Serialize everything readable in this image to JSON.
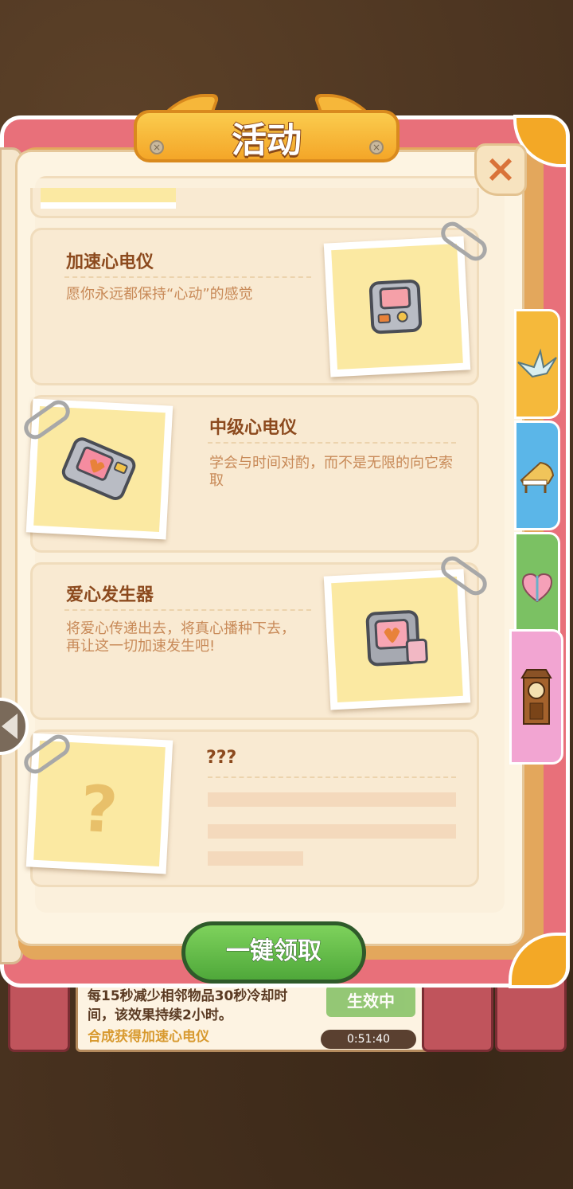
{
  "title": "活动",
  "close_icon": "×",
  "claim_button": "一键领取",
  "cards": [
    {
      "title": "加速心电仪",
      "desc": "愿你永远都保持“心动”的感觉"
    },
    {
      "title": "中级心电仪",
      "desc": "学会与时间对酌，而不是无限的向它索取"
    },
    {
      "title": "爱心发生器",
      "desc": "将爱心传递出去，将真心播种下去，再让这一切加速发生吧!"
    },
    {
      "title": "???",
      "question_mark": "?"
    }
  ],
  "tabs": [
    {
      "icon": "paper-crane-icon",
      "color": "#f5b93b"
    },
    {
      "icon": "piano-icon",
      "color": "#5bb6e8"
    },
    {
      "icon": "heart-box-icon",
      "color": "#7bc163"
    },
    {
      "icon": "grandfather-clock-icon",
      "color": "#f2a5d2"
    }
  ],
  "background_bar": {
    "info_text": "每15秒减少相邻物品30秒冷却时间，该效果持续2小时。",
    "info_sub": "合成获得加速心电仪",
    "active_label": "生效中",
    "timer": "0:51:40"
  }
}
